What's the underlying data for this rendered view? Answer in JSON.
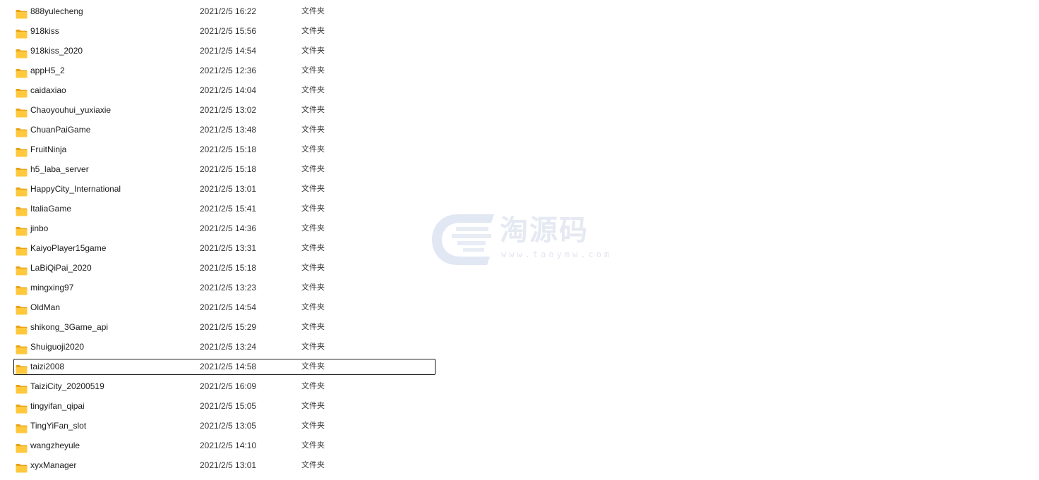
{
  "colors": {
    "folder_body": "#FFC83D",
    "folder_tab": "#E8A317",
    "focus_border": "#1A1A1A",
    "watermark": "#E3E7F1"
  },
  "icons": {
    "folder": "folder-icon"
  },
  "files": [
    {
      "name": "888yulecheng",
      "date": "2021/2/5 16:22",
      "type": "文件夹"
    },
    {
      "name": "918kiss",
      "date": "2021/2/5 15:56",
      "type": "文件夹"
    },
    {
      "name": "918kiss_2020",
      "date": "2021/2/5 14:54",
      "type": "文件夹"
    },
    {
      "name": "appH5_2",
      "date": "2021/2/5 12:36",
      "type": "文件夹"
    },
    {
      "name": "caidaxiao",
      "date": "2021/2/5 14:04",
      "type": "文件夹"
    },
    {
      "name": "Chaoyouhui_yuxiaxie",
      "date": "2021/2/5 13:02",
      "type": "文件夹"
    },
    {
      "name": "ChuanPaiGame",
      "date": "2021/2/5 13:48",
      "type": "文件夹"
    },
    {
      "name": "FruitNinja",
      "date": "2021/2/5 15:18",
      "type": "文件夹"
    },
    {
      "name": "h5_laba_server",
      "date": "2021/2/5 15:18",
      "type": "文件夹"
    },
    {
      "name": "HappyCity_International",
      "date": "2021/2/5 13:01",
      "type": "文件夹"
    },
    {
      "name": "ItaliaGame",
      "date": "2021/2/5 15:41",
      "type": "文件夹"
    },
    {
      "name": "jinbo",
      "date": "2021/2/5 14:36",
      "type": "文件夹"
    },
    {
      "name": "KaiyoPlayer15game",
      "date": "2021/2/5 13:31",
      "type": "文件夹"
    },
    {
      "name": "LaBiQiPai_2020",
      "date": "2021/2/5 15:18",
      "type": "文件夹"
    },
    {
      "name": "mingxing97",
      "date": "2021/2/5 13:23",
      "type": "文件夹"
    },
    {
      "name": "OldMan",
      "date": "2021/2/5 14:54",
      "type": "文件夹"
    },
    {
      "name": "shikong_3Game_api",
      "date": "2021/2/5 15:29",
      "type": "文件夹"
    },
    {
      "name": "Shuiguoji2020",
      "date": "2021/2/5 13:24",
      "type": "文件夹"
    },
    {
      "name": "taizi2008",
      "date": "2021/2/5 14:58",
      "type": "文件夹",
      "focused": true
    },
    {
      "name": "TaiziCity_20200519",
      "date": "2021/2/5 16:09",
      "type": "文件夹"
    },
    {
      "name": "tingyifan_qipai",
      "date": "2021/2/5 15:05",
      "type": "文件夹"
    },
    {
      "name": "TingYiFan_slot",
      "date": "2021/2/5 13:05",
      "type": "文件夹"
    },
    {
      "name": "wangzheyule",
      "date": "2021/2/5 14:10",
      "type": "文件夹"
    },
    {
      "name": "xyxManager",
      "date": "2021/2/5 13:01",
      "type": "文件夹"
    }
  ],
  "watermark": {
    "title": "淘源码",
    "url": "www.taoymw.com"
  }
}
